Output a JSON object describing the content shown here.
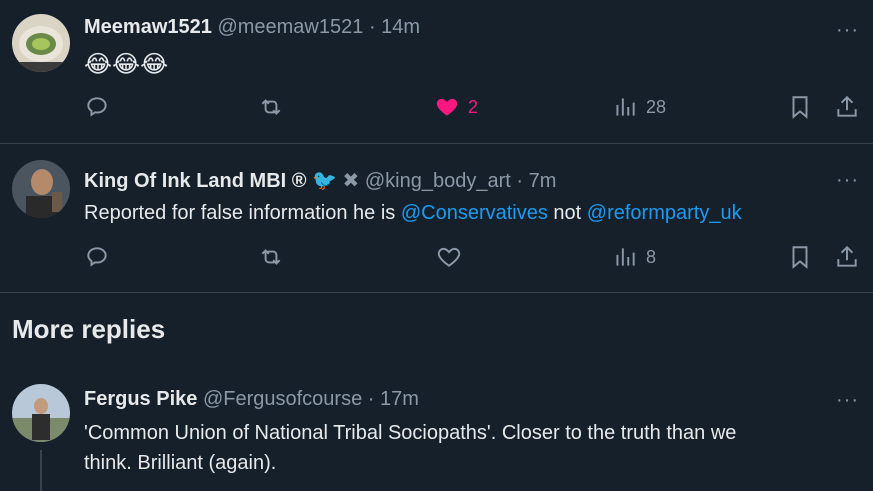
{
  "tweets": [
    {
      "name": "Meemaw1521",
      "handle": "@meemaw1521",
      "sep": "·",
      "time": "14m",
      "text": "😂😂😂",
      "likes": "2",
      "views": "28"
    },
    {
      "name": "King Of Ink Land MBI ®",
      "badge1": "🐦",
      "badge2": "✖",
      "handle": "@king_body_art",
      "sep": "·",
      "time": "7m",
      "text_prefix": "Reported for false information he is ",
      "mention1": "@Conservatives",
      "text_mid": " not ",
      "mention2": "@reformparty_uk",
      "views": "8"
    },
    {
      "name": "Fergus Pike",
      "handle": "@Fergusofcourse",
      "sep": "·",
      "time": "17m",
      "line1": "'Common Union of National Tribal Sociopaths'. Closer to the truth than we",
      "line2": "think. Brilliant (again)."
    }
  ],
  "section": {
    "more_replies": "More replies"
  },
  "more_dots": "···",
  "colors": {
    "bg": "#15202b",
    "text": "#e7e9ea",
    "muted": "#8b98a5",
    "accent": "#1d9bf0",
    "like": "#f91880",
    "divider": "#38444d"
  }
}
